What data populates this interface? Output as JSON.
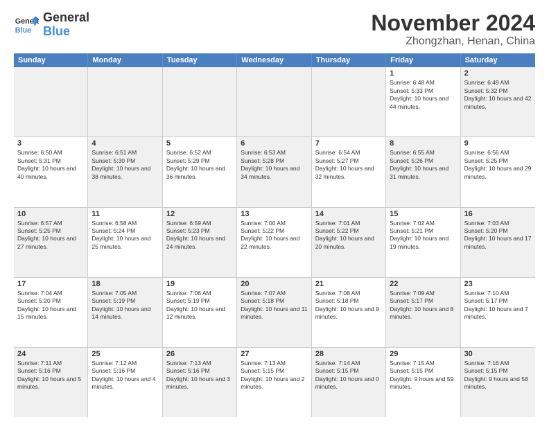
{
  "logo": {
    "line1": "General",
    "line2": "Blue"
  },
  "title": "November 2024",
  "subtitle": "Zhongzhan, Henan, China",
  "days_header": [
    "Sunday",
    "Monday",
    "Tuesday",
    "Wednesday",
    "Thursday",
    "Friday",
    "Saturday"
  ],
  "weeks": [
    [
      {
        "day": "",
        "info": "",
        "shaded": true
      },
      {
        "day": "",
        "info": "",
        "shaded": true
      },
      {
        "day": "",
        "info": "",
        "shaded": true
      },
      {
        "day": "",
        "info": "",
        "shaded": true
      },
      {
        "day": "",
        "info": "",
        "shaded": true
      },
      {
        "day": "1",
        "info": "Sunrise: 6:48 AM\nSunset: 5:33 PM\nDaylight: 10 hours and 44 minutes.",
        "shaded": false
      },
      {
        "day": "2",
        "info": "Sunrise: 6:49 AM\nSunset: 5:32 PM\nDaylight: 10 hours and 42 minutes.",
        "shaded": true
      }
    ],
    [
      {
        "day": "3",
        "info": "Sunrise: 6:50 AM\nSunset: 5:31 PM\nDaylight: 10 hours and 40 minutes.",
        "shaded": false
      },
      {
        "day": "4",
        "info": "Sunrise: 6:51 AM\nSunset: 5:30 PM\nDaylight: 10 hours and 38 minutes.",
        "shaded": true
      },
      {
        "day": "5",
        "info": "Sunrise: 6:52 AM\nSunset: 5:29 PM\nDaylight: 10 hours and 36 minutes.",
        "shaded": false
      },
      {
        "day": "6",
        "info": "Sunrise: 6:53 AM\nSunset: 5:28 PM\nDaylight: 10 hours and 34 minutes.",
        "shaded": true
      },
      {
        "day": "7",
        "info": "Sunrise: 6:54 AM\nSunset: 5:27 PM\nDaylight: 10 hours and 32 minutes.",
        "shaded": false
      },
      {
        "day": "8",
        "info": "Sunrise: 6:55 AM\nSunset: 5:26 PM\nDaylight: 10 hours and 31 minutes.",
        "shaded": true
      },
      {
        "day": "9",
        "info": "Sunrise: 6:56 AM\nSunset: 5:25 PM\nDaylight: 10 hours and 29 minutes.",
        "shaded": false
      }
    ],
    [
      {
        "day": "10",
        "info": "Sunrise: 6:57 AM\nSunset: 5:25 PM\nDaylight: 10 hours and 27 minutes.",
        "shaded": true
      },
      {
        "day": "11",
        "info": "Sunrise: 6:58 AM\nSunset: 5:24 PM\nDaylight: 10 hours and 25 minutes.",
        "shaded": false
      },
      {
        "day": "12",
        "info": "Sunrise: 6:59 AM\nSunset: 5:23 PM\nDaylight: 10 hours and 24 minutes.",
        "shaded": true
      },
      {
        "day": "13",
        "info": "Sunrise: 7:00 AM\nSunset: 5:22 PM\nDaylight: 10 hours and 22 minutes.",
        "shaded": false
      },
      {
        "day": "14",
        "info": "Sunrise: 7:01 AM\nSunset: 5:22 PM\nDaylight: 10 hours and 20 minutes.",
        "shaded": true
      },
      {
        "day": "15",
        "info": "Sunrise: 7:02 AM\nSunset: 5:21 PM\nDaylight: 10 hours and 19 minutes.",
        "shaded": false
      },
      {
        "day": "16",
        "info": "Sunrise: 7:03 AM\nSunset: 5:20 PM\nDaylight: 10 hours and 17 minutes.",
        "shaded": true
      }
    ],
    [
      {
        "day": "17",
        "info": "Sunrise: 7:04 AM\nSunset: 5:20 PM\nDaylight: 10 hours and 15 minutes.",
        "shaded": false
      },
      {
        "day": "18",
        "info": "Sunrise: 7:05 AM\nSunset: 5:19 PM\nDaylight: 10 hours and 14 minutes.",
        "shaded": true
      },
      {
        "day": "19",
        "info": "Sunrise: 7:06 AM\nSunset: 5:19 PM\nDaylight: 10 hours and 12 minutes.",
        "shaded": false
      },
      {
        "day": "20",
        "info": "Sunrise: 7:07 AM\nSunset: 5:18 PM\nDaylight: 10 hours and 11 minutes.",
        "shaded": true
      },
      {
        "day": "21",
        "info": "Sunrise: 7:08 AM\nSunset: 5:18 PM\nDaylight: 10 hours and 9 minutes.",
        "shaded": false
      },
      {
        "day": "22",
        "info": "Sunrise: 7:09 AM\nSunset: 5:17 PM\nDaylight: 10 hours and 8 minutes.",
        "shaded": true
      },
      {
        "day": "23",
        "info": "Sunrise: 7:10 AM\nSunset: 5:17 PM\nDaylight: 10 hours and 7 minutes.",
        "shaded": false
      }
    ],
    [
      {
        "day": "24",
        "info": "Sunrise: 7:11 AM\nSunset: 5:16 PM\nDaylight: 10 hours and 5 minutes.",
        "shaded": true
      },
      {
        "day": "25",
        "info": "Sunrise: 7:12 AM\nSunset: 5:16 PM\nDaylight: 10 hours and 4 minutes.",
        "shaded": false
      },
      {
        "day": "26",
        "info": "Sunrise: 7:13 AM\nSunset: 5:16 PM\nDaylight: 10 hours and 3 minutes.",
        "shaded": true
      },
      {
        "day": "27",
        "info": "Sunrise: 7:13 AM\nSunset: 5:15 PM\nDaylight: 10 hours and 2 minutes.",
        "shaded": false
      },
      {
        "day": "28",
        "info": "Sunrise: 7:14 AM\nSunset: 5:15 PM\nDaylight: 10 hours and 0 minutes.",
        "shaded": true
      },
      {
        "day": "29",
        "info": "Sunrise: 7:15 AM\nSunset: 5:15 PM\nDaylight: 9 hours and 59 minutes.",
        "shaded": false
      },
      {
        "day": "30",
        "info": "Sunrise: 7:16 AM\nSunset: 5:15 PM\nDaylight: 9 hours and 58 minutes.",
        "shaded": true
      }
    ]
  ]
}
